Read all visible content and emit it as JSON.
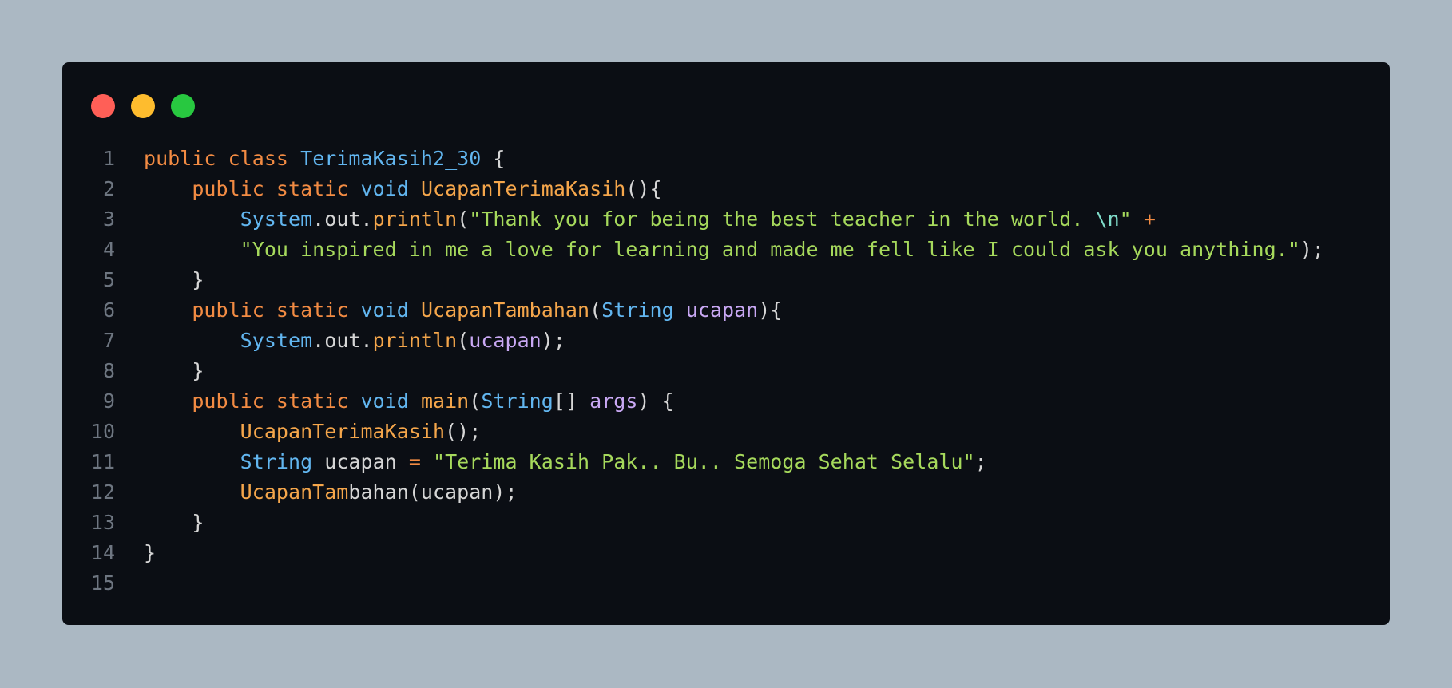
{
  "window": {
    "controls": [
      {
        "name": "close",
        "color": "#ff5f57"
      },
      {
        "name": "minimize",
        "color": "#febc2e"
      },
      {
        "name": "maximize",
        "color": "#28c840"
      }
    ]
  },
  "code": {
    "language": "java",
    "line_numbers": [
      "1",
      "2",
      "3",
      "4",
      "5",
      "6",
      "7",
      "8",
      "9",
      "10",
      "11",
      "12",
      "13",
      "14",
      "15"
    ],
    "lines": [
      [
        {
          "t": "kw",
          "v": "public"
        },
        {
          "t": "pl",
          "v": " "
        },
        {
          "t": "kw",
          "v": "class"
        },
        {
          "t": "pl",
          "v": " "
        },
        {
          "t": "ty",
          "v": "TerimaKasih2_30"
        },
        {
          "t": "pl",
          "v": " {"
        }
      ],
      [
        {
          "t": "pl",
          "v": "    "
        },
        {
          "t": "kw",
          "v": "public"
        },
        {
          "t": "pl",
          "v": " "
        },
        {
          "t": "kw",
          "v": "static"
        },
        {
          "t": "pl",
          "v": " "
        },
        {
          "t": "ty",
          "v": "void"
        },
        {
          "t": "pl",
          "v": " "
        },
        {
          "t": "fn",
          "v": "UcapanTerimaKasih"
        },
        {
          "t": "pl",
          "v": "(){"
        }
      ],
      [
        {
          "t": "pl",
          "v": "        "
        },
        {
          "t": "ty",
          "v": "System"
        },
        {
          "t": "pl",
          "v": ".out."
        },
        {
          "t": "fn",
          "v": "println"
        },
        {
          "t": "pl",
          "v": "("
        },
        {
          "t": "st",
          "v": "\"Thank you for being the best teacher in the world. "
        },
        {
          "t": "esc",
          "v": "\\n"
        },
        {
          "t": "st",
          "v": "\""
        },
        {
          "t": "pl",
          "v": " "
        },
        {
          "t": "op",
          "v": "+"
        }
      ],
      [
        {
          "t": "pl",
          "v": "        "
        },
        {
          "t": "st",
          "v": "\"You inspired in me a love for learning and made me fell like I could ask you anything.\""
        },
        {
          "t": "pl",
          "v": ");"
        }
      ],
      [
        {
          "t": "pl",
          "v": "    }"
        }
      ],
      [
        {
          "t": "pl",
          "v": "    "
        },
        {
          "t": "kw",
          "v": "public"
        },
        {
          "t": "pl",
          "v": " "
        },
        {
          "t": "kw",
          "v": "static"
        },
        {
          "t": "pl",
          "v": " "
        },
        {
          "t": "ty",
          "v": "void"
        },
        {
          "t": "pl",
          "v": " "
        },
        {
          "t": "fn",
          "v": "UcapanTambahan"
        },
        {
          "t": "pl",
          "v": "("
        },
        {
          "t": "ty",
          "v": "String"
        },
        {
          "t": "pl",
          "v": " "
        },
        {
          "t": "var",
          "v": "ucapan"
        },
        {
          "t": "pl",
          "v": "){"
        }
      ],
      [
        {
          "t": "pl",
          "v": "        "
        },
        {
          "t": "ty",
          "v": "System"
        },
        {
          "t": "pl",
          "v": ".out."
        },
        {
          "t": "fn",
          "v": "println"
        },
        {
          "t": "pl",
          "v": "("
        },
        {
          "t": "var",
          "v": "ucapan"
        },
        {
          "t": "pl",
          "v": ");"
        }
      ],
      [
        {
          "t": "pl",
          "v": "    }"
        }
      ],
      [
        {
          "t": "pl",
          "v": "    "
        },
        {
          "t": "kw",
          "v": "public"
        },
        {
          "t": "pl",
          "v": " "
        },
        {
          "t": "kw",
          "v": "static"
        },
        {
          "t": "pl",
          "v": " "
        },
        {
          "t": "ty",
          "v": "void"
        },
        {
          "t": "pl",
          "v": " "
        },
        {
          "t": "fn",
          "v": "main"
        },
        {
          "t": "pl",
          "v": "("
        },
        {
          "t": "ty",
          "v": "String"
        },
        {
          "t": "pl",
          "v": "[] "
        },
        {
          "t": "var",
          "v": "args"
        },
        {
          "t": "pl",
          "v": ") {"
        }
      ],
      [
        {
          "t": "pl",
          "v": "        "
        },
        {
          "t": "fn",
          "v": "UcapanTerimaKasih"
        },
        {
          "t": "pl",
          "v": "();"
        }
      ],
      [
        {
          "t": "pl",
          "v": "        "
        },
        {
          "t": "ty",
          "v": "String"
        },
        {
          "t": "pl",
          "v": " ucapan "
        },
        {
          "t": "op",
          "v": "="
        },
        {
          "t": "pl",
          "v": " "
        },
        {
          "t": "st",
          "v": "\"Terima Kasih Pak.. Bu.. Semoga Sehat Selalu\""
        },
        {
          "t": "pl",
          "v": ";"
        }
      ],
      [
        {
          "t": "pl",
          "v": "        "
        },
        {
          "t": "fn",
          "v": "UcapanTam"
        },
        {
          "t": "pl",
          "v": "bahan(ucapan);"
        }
      ],
      [
        {
          "t": "pl",
          "v": "    }"
        }
      ],
      [
        {
          "t": "pl",
          "v": "}"
        }
      ],
      []
    ]
  }
}
